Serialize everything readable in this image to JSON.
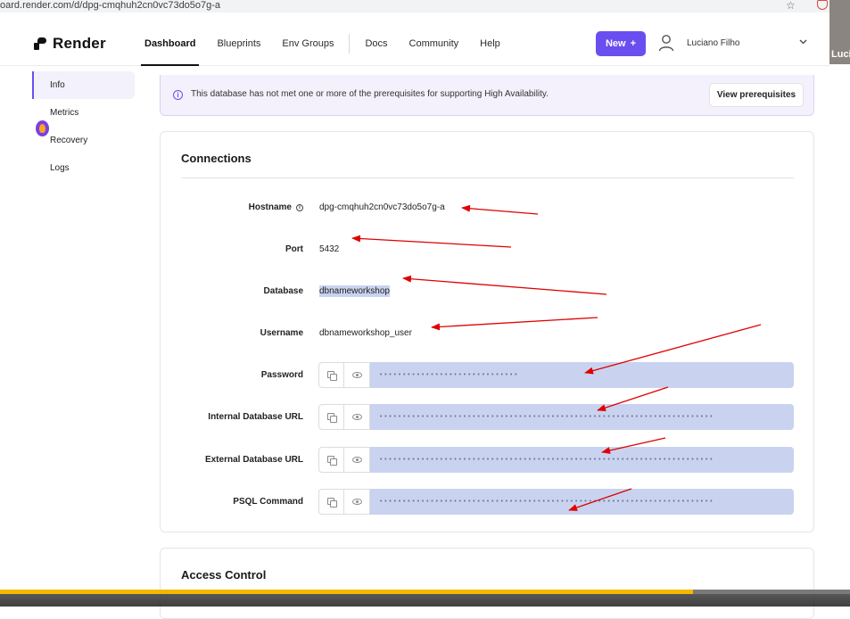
{
  "browser": {
    "url": "oard.render.com/d/dpg-cmqhuh2cn0vc73do5o7g-a",
    "participant": "Luci"
  },
  "nav": {
    "brand": "Render",
    "links": [
      "Dashboard",
      "Blueprints",
      "Env Groups",
      "Docs",
      "Community",
      "Help"
    ],
    "new_button": "New",
    "new_plus": "+",
    "user_name": "Luciano Filho"
  },
  "sidebar": {
    "items": [
      "Info",
      "Metrics",
      "Recovery",
      "Logs"
    ]
  },
  "banner": {
    "text": "This database has not met one or more of the prerequisites for supporting High Availability.",
    "button": "View prerequisites"
  },
  "connections": {
    "title": "Connections",
    "hostname_label": "Hostname",
    "hostname": "dpg-cmqhuh2cn0vc73do5o7g-a",
    "port_label": "Port",
    "port": "5432",
    "database_label": "Database",
    "database": "dbnameworkshop",
    "username_label": "Username",
    "username": "dbnameworkshop_user",
    "password_label": "Password",
    "password_mask": "••••••••••••••••••••••••••••••",
    "internal_label": "Internal Database URL",
    "internal_mask": "••••••••••••••••••••••••••••••••••••••••••••••••••••••••••••••••••••••••",
    "external_label": "External Database URL",
    "external_mask": "••••••••••••••••••••••••••••••••••••••••••••••••••••••••••••••••••••••••",
    "psql_label": "PSQL Command",
    "psql_mask": "••••••••••••••••••••••••••••••••••••••••••••••••••••••••••••••••••••••••"
  },
  "access_control": {
    "title": "Access Control"
  },
  "video_progress": 0.815,
  "colors": {
    "accent": "#6b4ef0",
    "annotation": "#e00000",
    "masked_field": "#c9d3f0",
    "progress": "#f5b700"
  }
}
